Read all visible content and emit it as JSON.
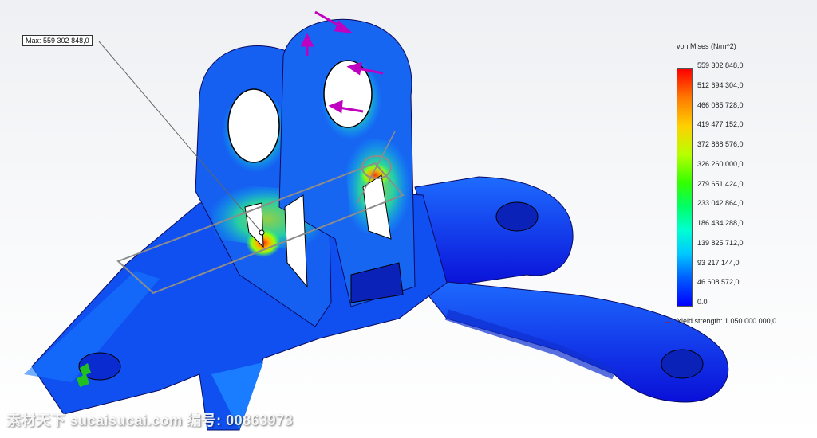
{
  "legend": {
    "title": "von Mises (N/m^2)",
    "ticks": [
      "559 302 848,0",
      "512 694 304,0",
      "466 085 728,0",
      "419 477 152,0",
      "372 868 576,0",
      "326 260 000,0",
      "279 651 424,0",
      "233 042 864,0",
      "186 434 288,0",
      "139 825 712,0",
      "93 217 144,0",
      "46 608 572,0",
      "0.0"
    ],
    "yield": "Yield strength: 1 050 000 000,0",
    "colors": [
      "#ff0000",
      "#ffd000",
      "#33ff00",
      "#00ffd2",
      "#0000ff"
    ]
  },
  "probe": {
    "label": "Max:",
    "value": "559 302 848,0"
  },
  "watermark": "素材天下 sucaisucai.com  编号: 00863973"
}
